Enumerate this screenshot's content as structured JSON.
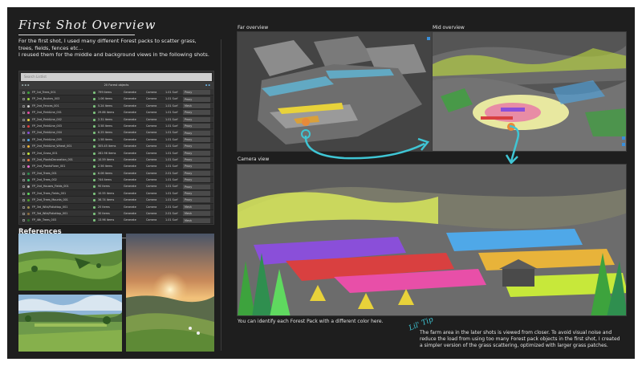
{
  "title": "First Shot Overview",
  "intro": {
    "line1": "For the first shot, I used many different Forest packs to scatter grass,",
    "line2": "trees, fields, fences etc...",
    "line3": "I reused them for the middle and background views in the following shots."
  },
  "table": {
    "search_placeholder": "Search Listlist",
    "header_title": "20 Forest objects",
    "header_left": "▪ ▪ ▪",
    "header_right": "▪ ▪",
    "rows": [
      {
        "name": "FP_1st_Trees_001",
        "items": "799 items",
        "mode": "Generate",
        "camera": "Camera",
        "surf": "1.01 Surf",
        "display": "Proxy",
        "color": "#3da33d"
      },
      {
        "name": "FP_2nd_Bushes_003",
        "items": "1.06 items",
        "mode": "Generate",
        "camera": "Camera",
        "surf": "1.01 Surf",
        "display": "Proxy",
        "color": "#9bd13f"
      },
      {
        "name": "FP_2nd_Fences_001",
        "items": "5.24 items",
        "mode": "Generate",
        "camera": "Camera",
        "surf": "1.01 Surf",
        "display": "Mesh",
        "color": "#c9c9c9"
      },
      {
        "name": "FP_2nd_FieldLine_001",
        "items": "29.86 items",
        "mode": "Generate",
        "camera": "Camera",
        "surf": "1.01 Surf",
        "display": "Proxy",
        "color": "#e84fa8"
      },
      {
        "name": "FP_2nd_FieldLine_002",
        "items": "2.31 items",
        "mode": "Generate",
        "camera": "Camera",
        "surf": "1.01 Surf",
        "display": "Proxy",
        "color": "#e8d23a"
      },
      {
        "name": "FP_2nd_FieldLine_003",
        "items": "3.58 items",
        "mode": "Generate",
        "camera": "Camera",
        "surf": "1.01 Surf",
        "display": "Proxy",
        "color": "#d94040"
      },
      {
        "name": "FP_2nd_FieldLine_004",
        "items": "8.25 items",
        "mode": "Generate",
        "camera": "Camera",
        "surf": "1.01 Surf",
        "display": "Proxy",
        "color": "#8a4fd9"
      },
      {
        "name": "FP_2nd_FieldLine_005",
        "items": "1.58 items",
        "mode": "Generate",
        "camera": "Camera",
        "surf": "1.01 Surf",
        "display": "Proxy",
        "color": "#4fa8e8"
      },
      {
        "name": "FP_2nd_FieldLine_Wheat_001",
        "items": "305.45 items",
        "mode": "Generate",
        "camera": "Camera",
        "surf": "1.01 Surf",
        "display": "Proxy",
        "color": "#e8b33a"
      },
      {
        "name": "FP_2nd_Grass_001",
        "items": "282.96 items",
        "mode": "Generate",
        "camera": "Camera",
        "surf": "1.01 Surf",
        "display": "Proxy",
        "color": "#c7e83a"
      },
      {
        "name": "FP_2nd_PlantsDecoration_001",
        "items": "10.59 items",
        "mode": "Generate",
        "camera": "Camera",
        "surf": "1.01 Surf",
        "display": "Proxy",
        "color": "#e87a3a"
      },
      {
        "name": "FP_2nd_PlantsFlwer_001",
        "items": "2.56 items",
        "mode": "Generate",
        "camera": "Camera",
        "surf": "1.01 Surf",
        "display": "Proxy",
        "color": "#f06fd0"
      },
      {
        "name": "FP_2nd_Trees_001",
        "items": "6.06 items",
        "mode": "Generate",
        "camera": "Camera",
        "surf": "2.01 Surf",
        "display": "Proxy",
        "color": "#2f8f4f"
      },
      {
        "name": "FP_2nd_Trees_002",
        "items": "744 items",
        "mode": "Generate",
        "camera": "Camera",
        "surf": "1.01 Surf",
        "display": "Proxy",
        "color": "#3fbf6f"
      },
      {
        "name": "FP_2nd_Houses_Fields_001",
        "items": "90 items",
        "mode": "Generate",
        "camera": "Camera",
        "surf": "1.01 Surf",
        "display": "Proxy",
        "color": "#b0b0b0"
      },
      {
        "name": "FP_2nd_Trees_Fields_001",
        "items": "10.55 items",
        "mode": "Generate",
        "camera": "Camera",
        "surf": "1.01 Surf",
        "display": "Proxy",
        "color": "#5fd95f"
      },
      {
        "name": "FP_2nd_Trees_Mounts_001",
        "items": "36.74 items",
        "mode": "Generate",
        "camera": "Camera",
        "surf": "1.01 Surf",
        "display": "Proxy",
        "color": "#4f9f2f"
      },
      {
        "name": "FP_3rd_Wild/Foliottop_001",
        "items": "25 items",
        "mode": "Generate",
        "camera": "Camera",
        "surf": "2.01 Surf",
        "display": "Mesh",
        "color": "#9f8f4f"
      },
      {
        "name": "FP_3rd_Wild/Foliottop_001",
        "items": "30 items",
        "mode": "Generate",
        "camera": "Camera",
        "surf": "2.01 Surf",
        "display": "Mesh",
        "color": "#8f6f3f"
      },
      {
        "name": "FP_4th_Trees_003",
        "items": "13.96 items",
        "mode": "Generate",
        "camera": "Camera",
        "surf": "1.01 Surf",
        "display": "Mesh",
        "color": "#2f6f2f"
      }
    ]
  },
  "references": {
    "title": "References"
  },
  "caption_left": "You can identify each Forest Pack with a different color here.",
  "viewports": {
    "far": "Far overview",
    "mid": "Mid overview",
    "camera": "Camera view"
  },
  "tip": {
    "label": "Lil' Tip",
    "text1": "The farm area in the later shots is viewed from closer. To avoid visual noise and",
    "text2": "reduce the load from using too many Forest pack objects in the first shot, I created",
    "text3": "a simpler version of the grass scattering, optimized with larger grass patches."
  },
  "colors": {
    "accent": "#3fc5d4",
    "background": "#1e1e1e"
  }
}
